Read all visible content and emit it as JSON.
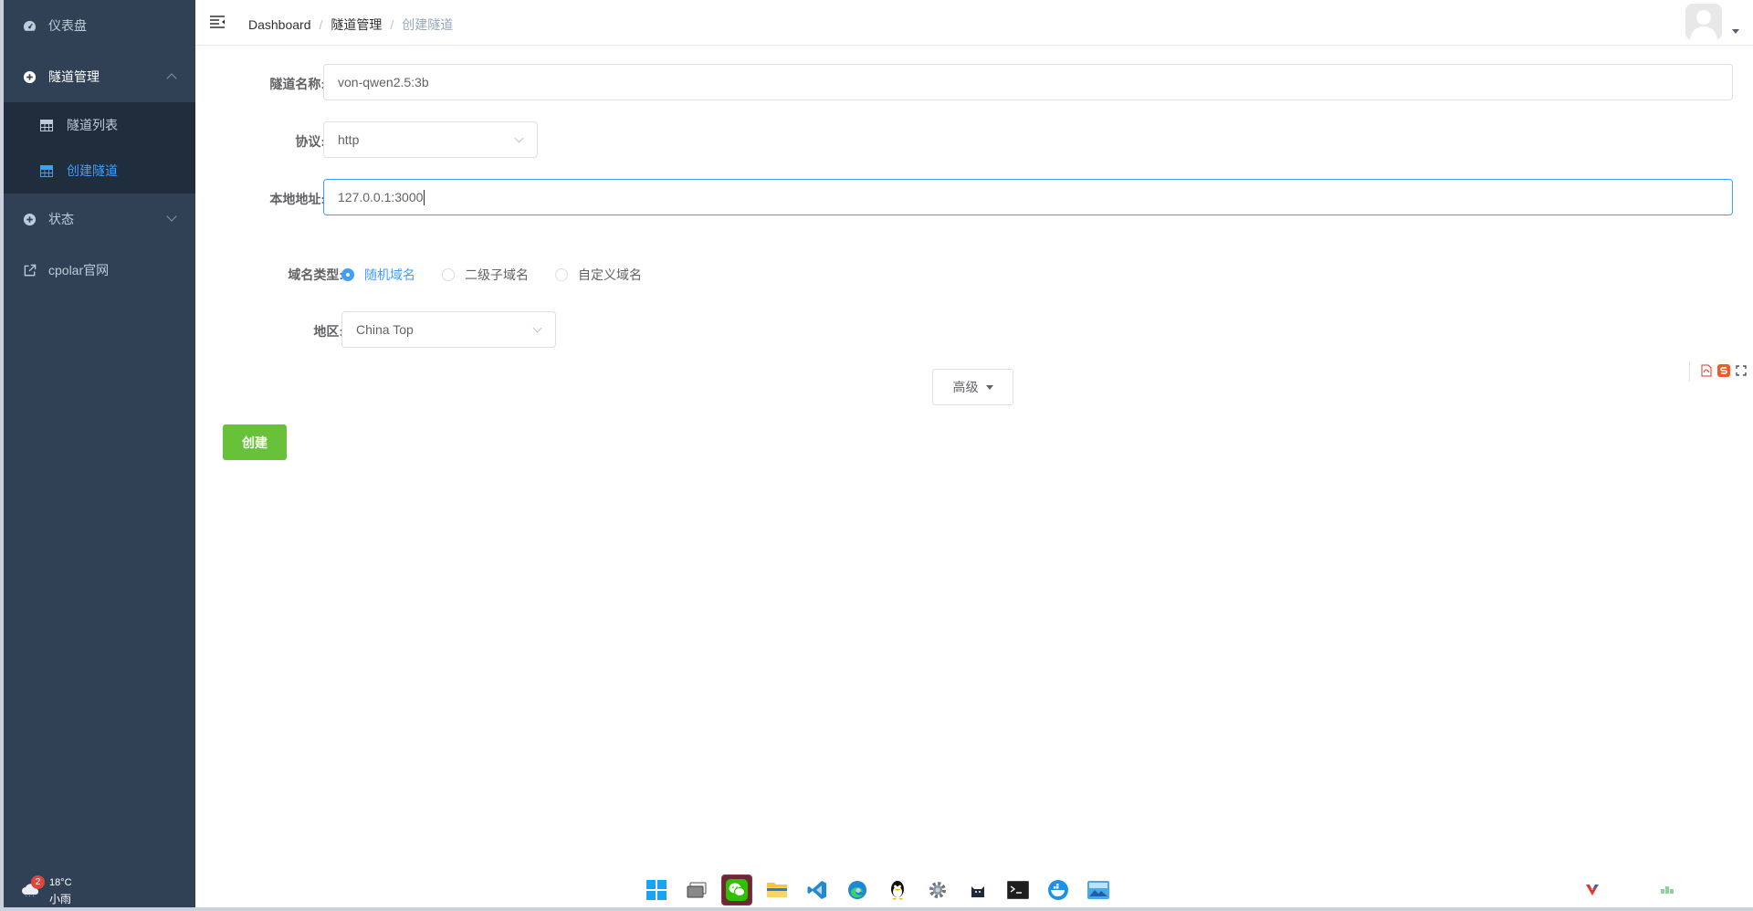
{
  "sidebar": {
    "items": [
      {
        "label": "仪表盘",
        "icon": "dashboard-icon"
      },
      {
        "label": "隧道管理",
        "icon": "plus-circle-icon",
        "expanded": true,
        "children": [
          {
            "label": "隧道列表",
            "icon": "table-icon"
          },
          {
            "label": "创建隧道",
            "icon": "table-icon",
            "active": true
          }
        ]
      },
      {
        "label": "状态",
        "icon": "plus-circle-icon",
        "expanded": false
      },
      {
        "label": "cpolar官网",
        "icon": "external-link-icon"
      }
    ]
  },
  "breadcrumb": [
    "Dashboard",
    "隧道管理",
    "创建隧道"
  ],
  "form": {
    "name_label": "隧道名称:",
    "name_value": "von-qwen2.5:3b",
    "protocol_label": "协议:",
    "protocol_value": "http",
    "local_label": "本地地址:",
    "local_value": "127.0.0.1:3000",
    "domain_type_label": "域名类型:",
    "domain_options": [
      "随机域名",
      "二级子域名",
      "自定义域名"
    ],
    "domain_selected": "随机域名",
    "region_label": "地区:",
    "region_value": "China Top",
    "advanced_label": "高级",
    "create_label": "创建"
  },
  "weather": {
    "badge": "2",
    "temp": "18°C",
    "desc": "小雨"
  },
  "taskbar": [
    "start-icon",
    "task-view-icon",
    "wechat-icon",
    "file-explorer-icon",
    "vscode-icon",
    "edge-icon",
    "qq-icon",
    "settings-icon",
    "cat-app-icon",
    "terminal-icon",
    "docker-icon",
    "photos-icon"
  ],
  "colors": {
    "sidebar": "#304156",
    "submenu": "#1f2d3d",
    "accent": "#409eff",
    "create_button": "#67c23a"
  }
}
